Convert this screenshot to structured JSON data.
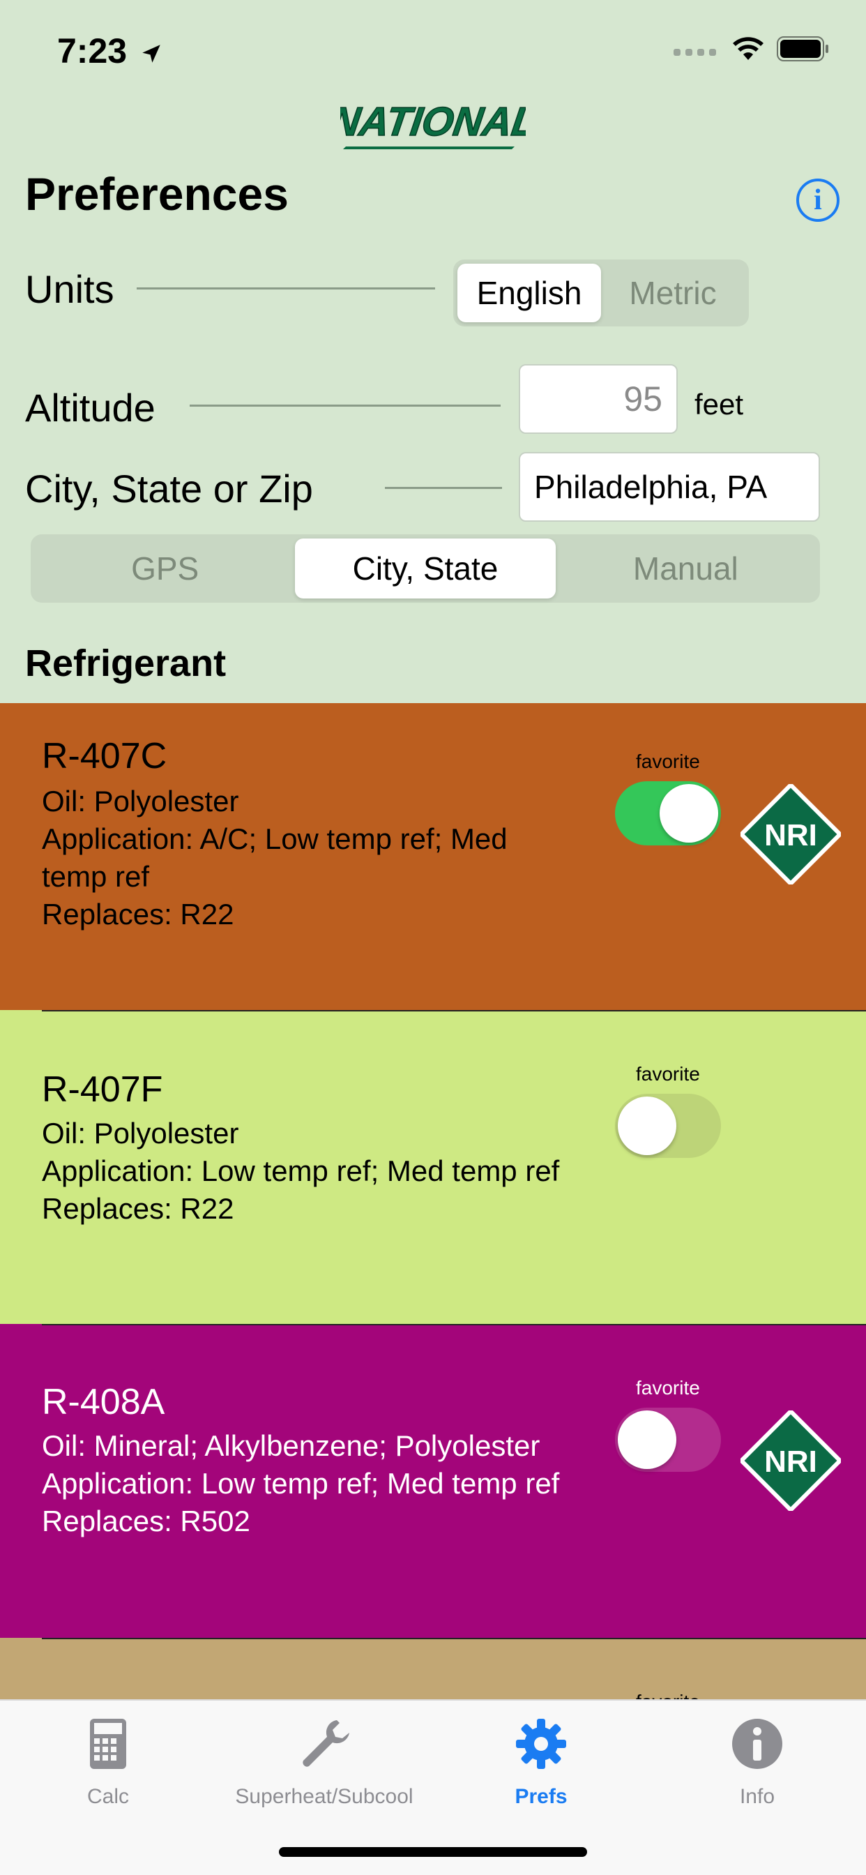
{
  "status": {
    "time": "7:23"
  },
  "brand": {
    "logo_text": "NATIONAL"
  },
  "header": {
    "title": "Preferences"
  },
  "units": {
    "label": "Units",
    "options": [
      "English",
      "Metric"
    ],
    "selected": "English"
  },
  "altitude": {
    "label": "Altitude",
    "value": "95",
    "unit": "feet"
  },
  "location": {
    "label": "City, State or Zip",
    "value": "Philadelphia, PA",
    "modes": [
      "GPS",
      "City, State",
      "Manual"
    ],
    "selected_mode": "City, State"
  },
  "refrigerant": {
    "title": "Refrigerant",
    "items": [
      {
        "name": "R-407C",
        "oil": "Oil: Polyolester",
        "application": "Application: A/C; Low temp ref; Med temp ref",
        "replaces": "Replaces: R22",
        "favorite_label": "favorite",
        "favorite": true,
        "has_nri": true,
        "nri_text": "NRI",
        "color": "#bb5e1f"
      },
      {
        "name": "R-407F",
        "oil": "Oil: Polyolester",
        "application": "Application: Low temp ref; Med temp ref",
        "replaces": "Replaces: R22",
        "favorite_label": "favorite",
        "favorite": false,
        "has_nri": false,
        "color": "#cee983"
      },
      {
        "name": "R-408A",
        "oil": "Oil: Mineral; Alkylbenzene; Polyolester",
        "application": "Application: Low temp ref; Med temp ref",
        "replaces": "Replaces: R502",
        "favorite_label": "favorite",
        "favorite": false,
        "has_nri": true,
        "nri_text": "NRI",
        "color": "#a3057a"
      },
      {
        "favorite_label": "favorite",
        "color": "#c2a774"
      }
    ]
  },
  "tabs": [
    {
      "label": "Calc",
      "icon": "calculator-icon",
      "active": false
    },
    {
      "label": "Superheat/Subcool",
      "icon": "wrench-icon",
      "active": false
    },
    {
      "label": "Prefs",
      "icon": "gear-icon",
      "active": true
    },
    {
      "label": "Info",
      "icon": "info-icon",
      "active": false
    }
  ],
  "colors": {
    "accent": "#1a7cf2",
    "toggle_on": "#34c759",
    "background": "#d6e7d0",
    "nri_green": "#0b6a45"
  }
}
